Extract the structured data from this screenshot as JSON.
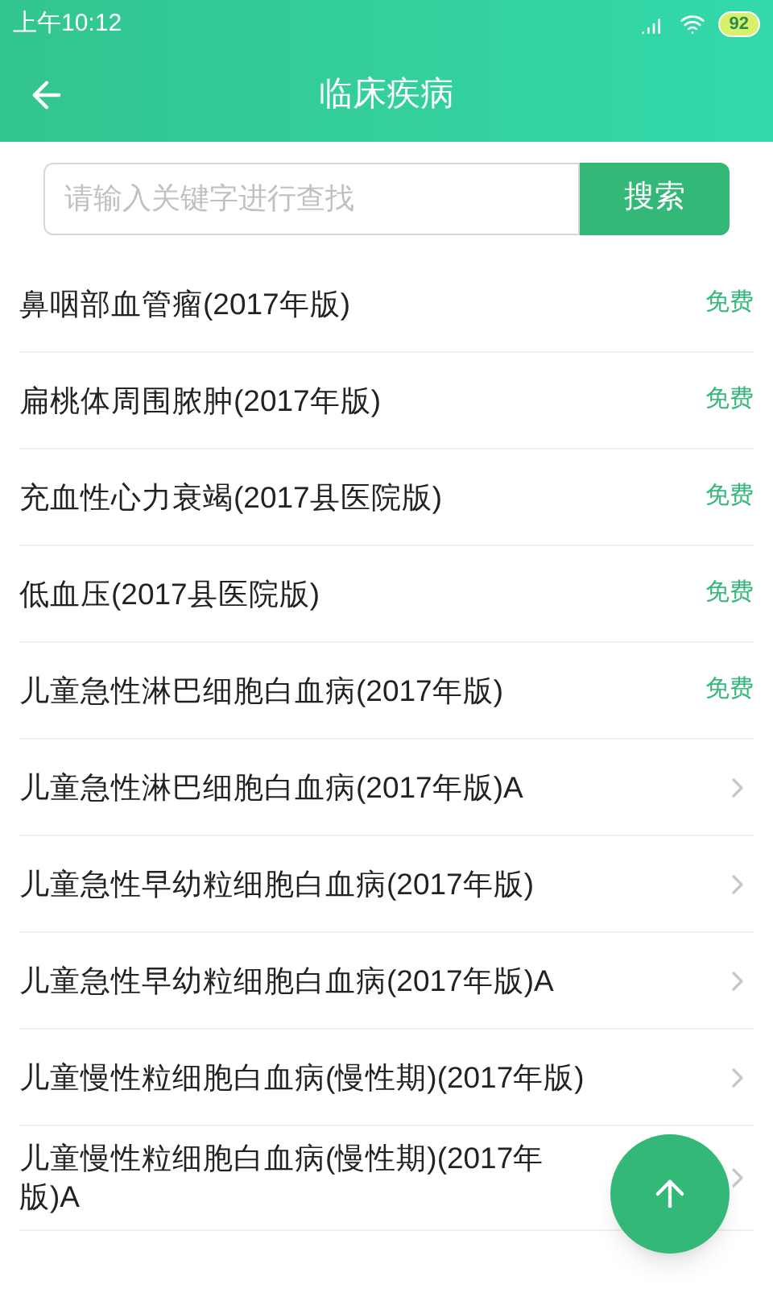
{
  "status_bar": {
    "time": "上午10:12",
    "battery": "92"
  },
  "header": {
    "title": "临床疾病"
  },
  "search": {
    "placeholder": "请输入关键字进行查找",
    "button": "搜索"
  },
  "items": [
    {
      "title": "鼻咽部血管瘤(2017年版)",
      "kind": "free",
      "badge": "免费"
    },
    {
      "title": "扁桃体周围脓肿(2017年版)",
      "kind": "free",
      "badge": "免费"
    },
    {
      "title": "充血性心力衰竭(2017县医院版)",
      "kind": "free",
      "badge": "免费"
    },
    {
      "title": "低血压(2017县医院版)",
      "kind": "free",
      "badge": "免费"
    },
    {
      "title": "儿童急性淋巴细胞白血病(2017年版)",
      "kind": "free",
      "badge": "免费"
    },
    {
      "title": "儿童急性淋巴细胞白血病(2017年版)A",
      "kind": "link"
    },
    {
      "title": "儿童急性早幼粒细胞白血病(2017年版)",
      "kind": "link"
    },
    {
      "title": "儿童急性早幼粒细胞白血病(2017年版)A",
      "kind": "link"
    },
    {
      "title": "儿童慢性粒细胞白血病(慢性期)(2017年版)",
      "kind": "link"
    },
    {
      "title": "儿童慢性粒细胞白血病(慢性期)(2017年版)A",
      "kind": "link"
    }
  ]
}
